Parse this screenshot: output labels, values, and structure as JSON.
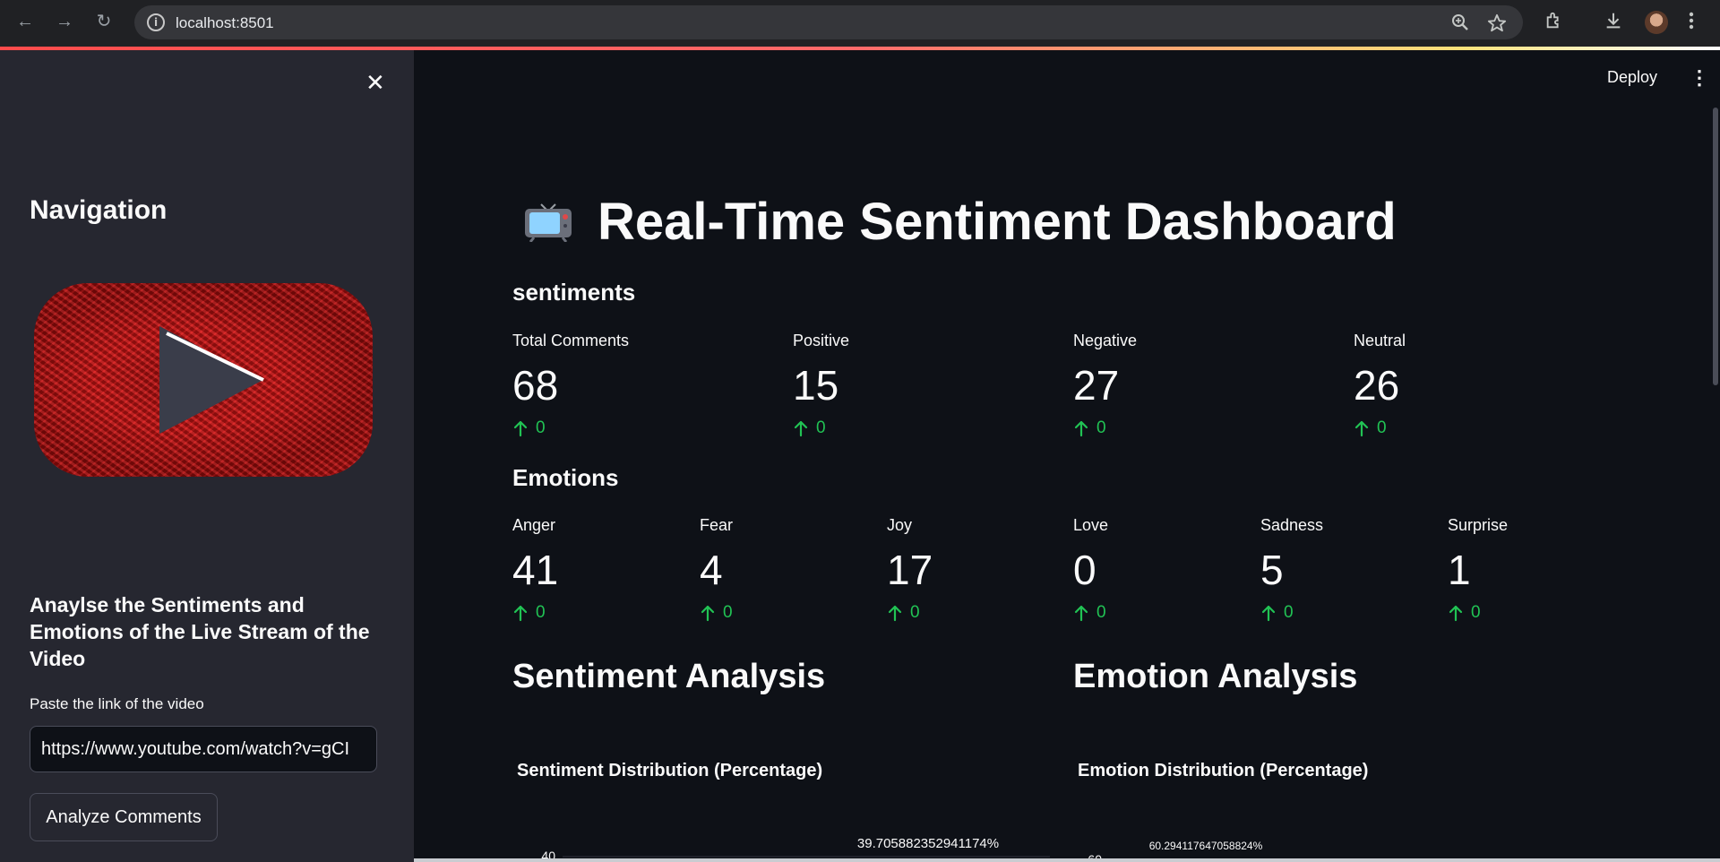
{
  "browser": {
    "url": "localhost:8501",
    "info_glyph": "i",
    "back_glyph": "←",
    "forward_glyph": "→",
    "reload_glyph": "↻"
  },
  "sidebar": {
    "close_glyph": "✕",
    "title": "Navigation",
    "heading": "Anaylse the Sentiments and Emotions of the Live Stream of the Video",
    "input_label": "Paste the link of the video",
    "input_value": "https://www.youtube.com/watch?v=gCI",
    "button_label": "Analyze Comments"
  },
  "header": {
    "deploy_label": "Deploy",
    "menu_glyph": "⋮"
  },
  "page": {
    "title": "Real-Time Sentiment Dashboard",
    "sentiments_heading": "sentiments",
    "emotions_heading": "Emotions",
    "sentiment_analysis_heading": "Sentiment Analysis",
    "emotion_analysis_heading": "Emotion Analysis"
  },
  "sentiment_metrics": [
    {
      "label": "Total Comments",
      "value": "68",
      "delta": "0"
    },
    {
      "label": "Positive",
      "value": "15",
      "delta": "0"
    },
    {
      "label": "Negative",
      "value": "27",
      "delta": "0"
    },
    {
      "label": "Neutral",
      "value": "26",
      "delta": "0"
    }
  ],
  "emotion_metrics": [
    {
      "label": "Anger",
      "value": "41",
      "delta": "0"
    },
    {
      "label": "Fear",
      "value": "4",
      "delta": "0"
    },
    {
      "label": "Joy",
      "value": "17",
      "delta": "0"
    },
    {
      "label": "Love",
      "value": "0",
      "delta": "0"
    },
    {
      "label": "Sadness",
      "value": "5",
      "delta": "0"
    },
    {
      "label": "Surprise",
      "value": "1",
      "delta": "0"
    }
  ],
  "colors": {
    "delta_green": "#21c354",
    "bar_blue": "#83c9ff"
  },
  "chart_data": [
    {
      "type": "bar",
      "title": "Sentiment Distribution (Percentage)",
      "y_tick_visible": "40",
      "data_label_visible": "39.705882352941174%"
    },
    {
      "type": "bar",
      "title": "Emotion Distribution (Percentage)",
      "y_tick_visible": "60",
      "data_label_visible": "60.294117647058824%"
    }
  ]
}
